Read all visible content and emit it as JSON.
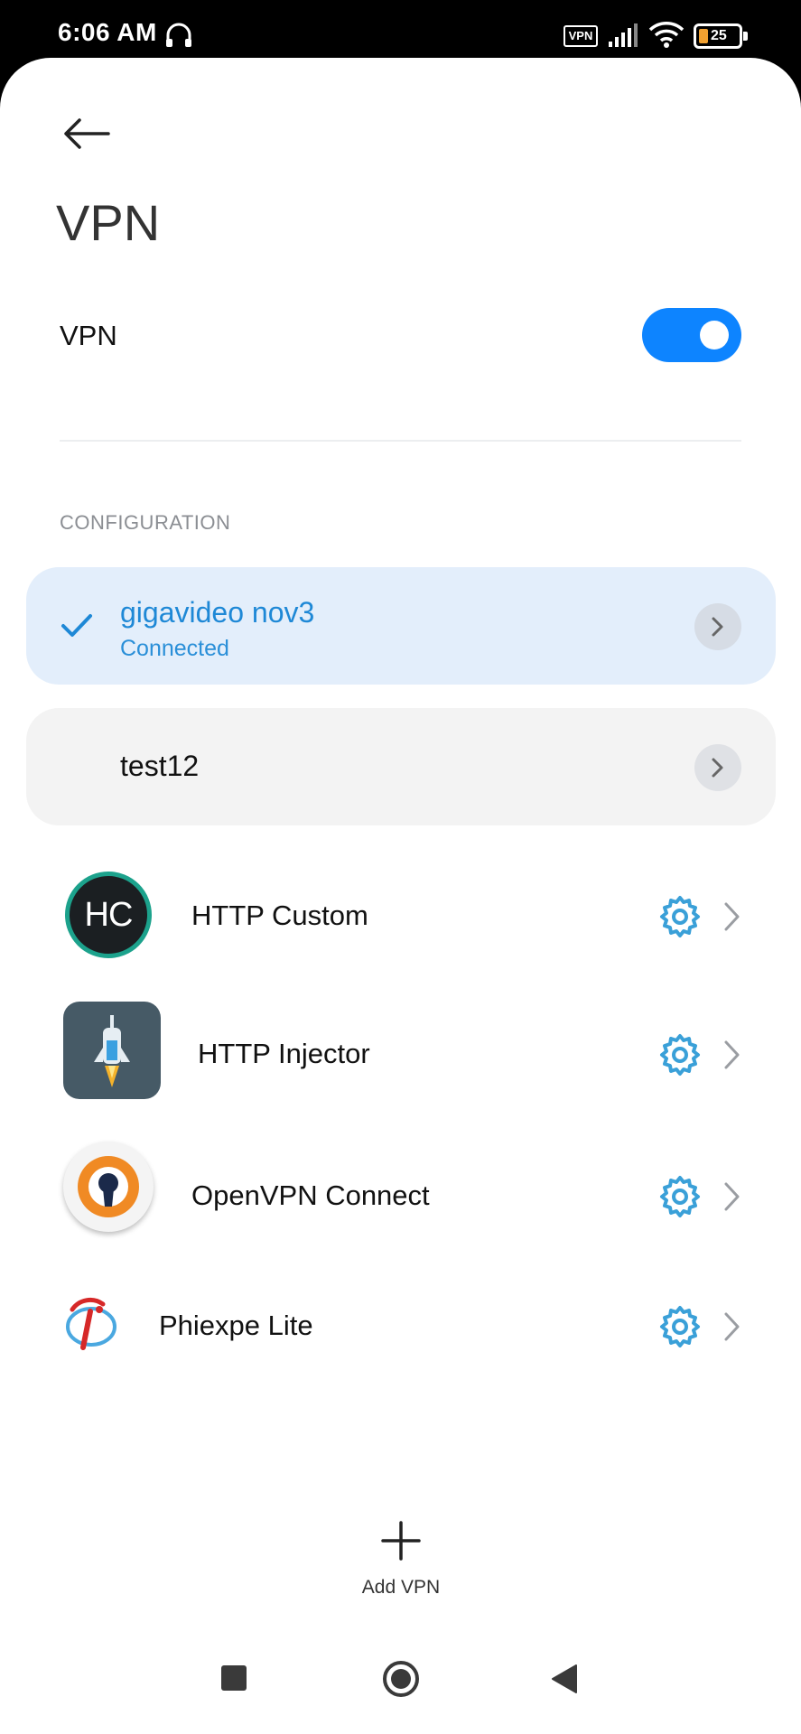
{
  "status_bar": {
    "time": "6:06 AM",
    "vpn_badge": "VPN",
    "battery": "25"
  },
  "header": {
    "title": "VPN"
  },
  "vpn_toggle": {
    "label": "VPN",
    "enabled": true
  },
  "section": {
    "configuration_header": "CONFIGURATION"
  },
  "configs": [
    {
      "name": "gigavideo nov3",
      "status": "Connected",
      "selected": true
    },
    {
      "name": "test12",
      "status": "",
      "selected": false
    }
  ],
  "apps": [
    {
      "name": "HTTP Custom",
      "icon": "http-custom-logo",
      "logo_text": "HC"
    },
    {
      "name": "HTTP Injector",
      "icon": "http-injector-logo"
    },
    {
      "name": "OpenVPN Connect",
      "icon": "openvpn-logo"
    },
    {
      "name": "Phiexpe Lite",
      "icon": "phiexpe-logo"
    }
  ],
  "add_vpn": {
    "label": "Add VPN"
  },
  "colors": {
    "accent": "#0d84ff",
    "selected_card": "#e3eefb",
    "card": "#f3f3f3",
    "gear": "#3aa0d8"
  }
}
